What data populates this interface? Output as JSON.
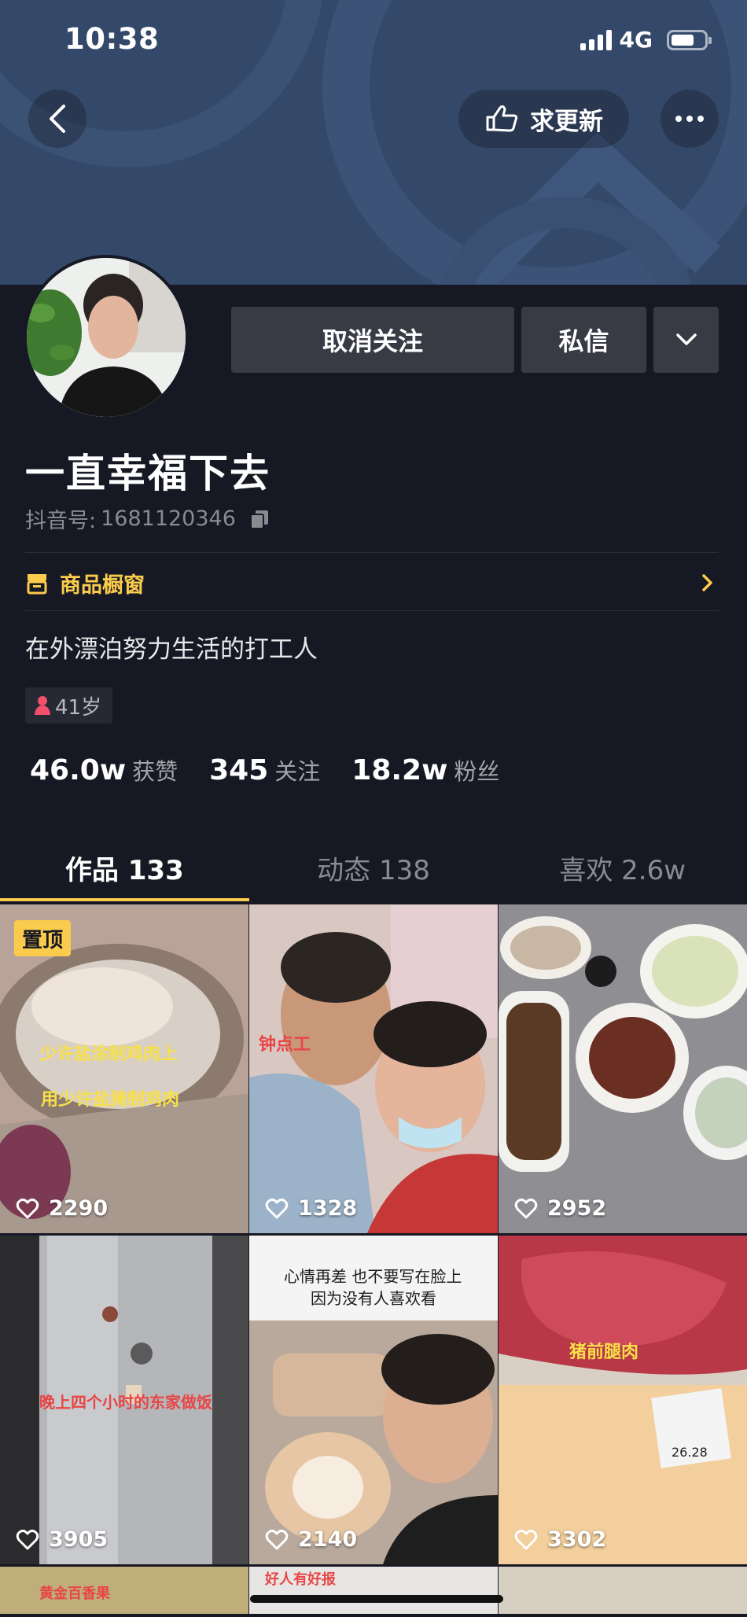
{
  "status": {
    "time": "10:38",
    "network": "4G"
  },
  "header": {
    "update_label": "求更新"
  },
  "profile": {
    "nickname": "一直幸福下去",
    "douyin_id_label": "抖音号:",
    "douyin_id": "1681120346",
    "bio": "在外漂泊努力生活的打工人",
    "age": "41岁"
  },
  "actions": {
    "unfollow_label": "取消关注",
    "message_label": "私信"
  },
  "shop": {
    "label": "商品橱窗"
  },
  "stats": [
    {
      "value": "46.0w",
      "label": "获赞"
    },
    {
      "value": "345",
      "label": "关注"
    },
    {
      "value": "18.2w",
      "label": "粉丝"
    }
  ],
  "tabs": [
    {
      "label": "作品 133",
      "active": true
    },
    {
      "label": "动态 138",
      "active": false
    },
    {
      "label": "喜欢 2.6w",
      "active": false
    }
  ],
  "videos": [
    {
      "likes": "2290",
      "pinned": true,
      "pin_label": "置顶",
      "caption1": "少许盐涂制鸡肉上",
      "caption2": "用少许盐腌制鸡肉"
    },
    {
      "likes": "1328",
      "caption1": "钟点工"
    },
    {
      "likes": "2952"
    },
    {
      "likes": "3905",
      "caption1": "晚上四个小时的东家做饭"
    },
    {
      "likes": "2140",
      "caption1": "心情再差 也不要写在脸上",
      "caption2": "因为没有人喜欢看"
    },
    {
      "likes": "3302",
      "caption1": "猪前腿肉",
      "price": "26.28"
    }
  ],
  "partial_row": [
    {
      "caption1": "黄金百香果"
    },
    {
      "caption1": "好人有好报"
    },
    {
      "caption1": ""
    }
  ],
  "colors": {
    "accent": "#facb4c",
    "background": "#161823",
    "button": "#393b44",
    "cover": "#34496a"
  }
}
